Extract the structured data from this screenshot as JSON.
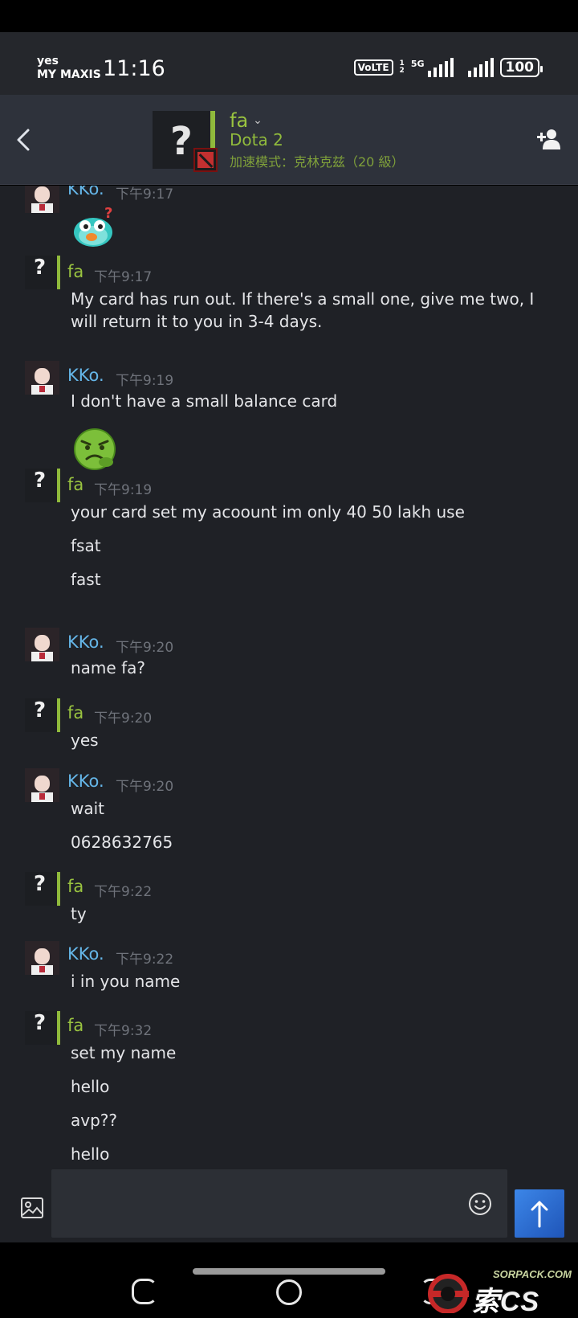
{
  "status_bar": {
    "line1": "yes",
    "carrier": "MY MAXIS",
    "time": "11:16",
    "volte": "VoLTE",
    "sim_top": "1",
    "sim_bottom": "2",
    "network": "5G",
    "battery": "100"
  },
  "header": {
    "contact_name": "fa",
    "game": "Dota 2",
    "mode": "加速模式：克林克兹（20 級）"
  },
  "messages": [
    {
      "sender": "KKo.",
      "time": "下午9:17",
      "lines": [],
      "sticker": "bird-sticker"
    },
    {
      "sender": "fa",
      "time": "下午9:17",
      "lines": [
        "My card has run out. If there's a small one, give me two, I will return it to you in 3-4 days."
      ]
    },
    {
      "sender": "KKo.",
      "time": "下午9:19",
      "lines": [
        "I don't have a small balance card"
      ],
      "sticker": "frog-sticker"
    },
    {
      "sender": "fa",
      "time": "下午9:19",
      "lines": [
        "your card set my acoount im only 40 50 lakh use",
        "fsat",
        "fast"
      ]
    },
    {
      "sender": "KKo.",
      "time": "下午9:20",
      "lines": [
        "name fa?"
      ]
    },
    {
      "sender": "fa",
      "time": "下午9:20",
      "lines": [
        "yes"
      ]
    },
    {
      "sender": "KKo.",
      "time": "下午9:20",
      "lines": [
        "wait",
        "0628632765"
      ]
    },
    {
      "sender": "fa",
      "time": "下午9:22",
      "lines": [
        "ty"
      ]
    },
    {
      "sender": "KKo.",
      "time": "下午9:22",
      "lines": [
        "i in you name"
      ]
    },
    {
      "sender": "fa",
      "time": "下午9:32",
      "lines": [
        "set my name",
        "hello",
        "avp??",
        "hello"
      ]
    }
  ],
  "composer": {
    "placeholder": ""
  },
  "watermark": {
    "site": "SORPACK.COM",
    "brand_cn": "索",
    "brand_latin": "CS"
  },
  "colors": {
    "accent_green": "#90ba3c",
    "kko_blue": "#65b6e8",
    "send_blue": "#2f6fd0",
    "chat_bg": "#1f2126"
  }
}
